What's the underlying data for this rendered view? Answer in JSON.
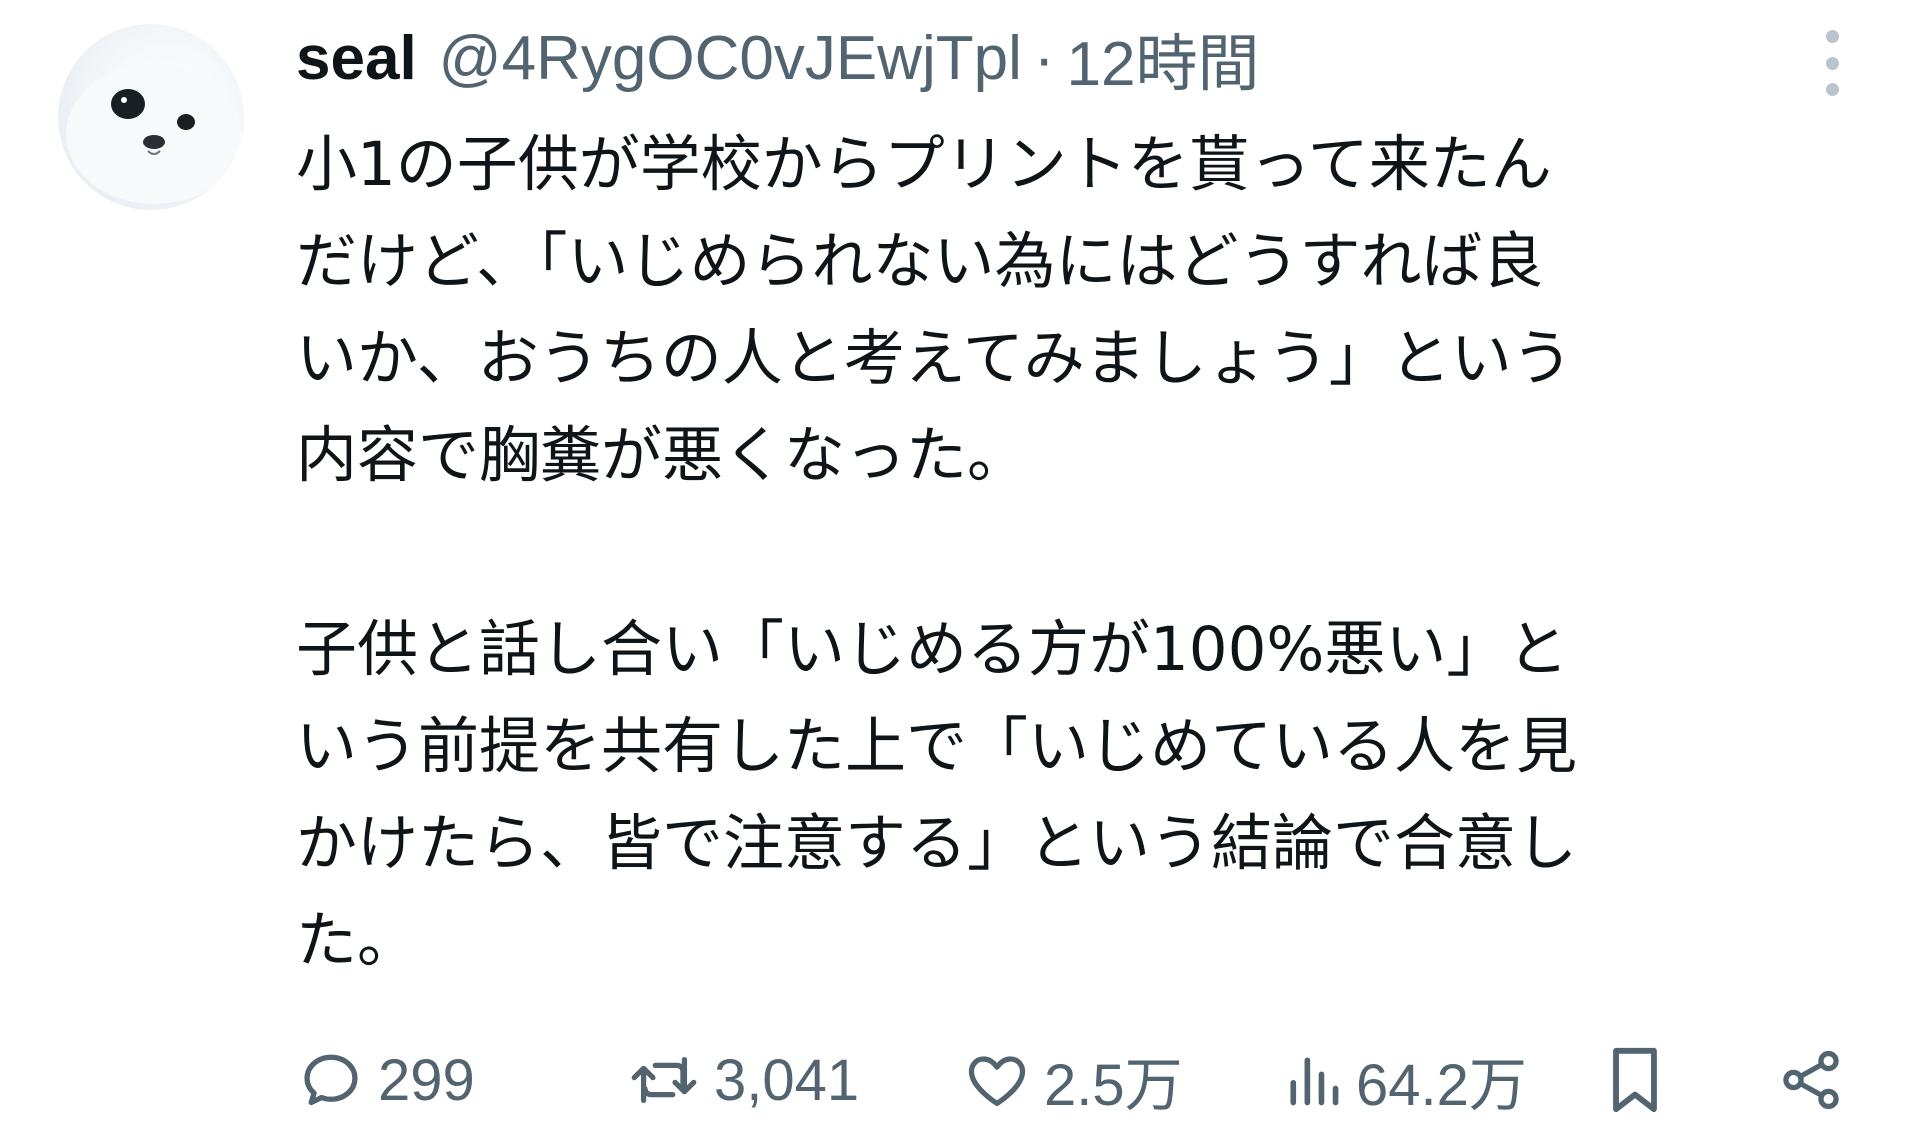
{
  "author": {
    "display_name": "seal",
    "handle": "@4RygOC0vJEwjTpl",
    "separator": "·",
    "time": "12時間"
  },
  "tweet": {
    "lines": [
      "小1の子供が学校からプリントを貰って来たん",
      "だけど、「いじめられない為にはどうすれば良",
      "いか、おうちの人と考えてみましょう」という",
      "内容で胸糞が悪くなった。",
      "",
      "子供と話し合い「いじめる方が100%悪い」と",
      "いう前提を共有した上で「いじめている人を見",
      "かけたら、皆で注意する」という結論で合意し",
      "た。"
    ]
  },
  "actions": {
    "reply": {
      "icon": "reply-icon",
      "count": "299"
    },
    "repost": {
      "icon": "repost-icon",
      "count": "3,041"
    },
    "like": {
      "icon": "heart-icon",
      "count": "2.5万"
    },
    "views": {
      "icon": "views-icon",
      "count": "64.2万"
    },
    "bookmark": {
      "icon": "bookmark-icon"
    },
    "share": {
      "icon": "share-icon"
    }
  },
  "colors": {
    "text": "#0f1419",
    "secondary": "#536471",
    "more_dots": "#b9c4cc"
  }
}
